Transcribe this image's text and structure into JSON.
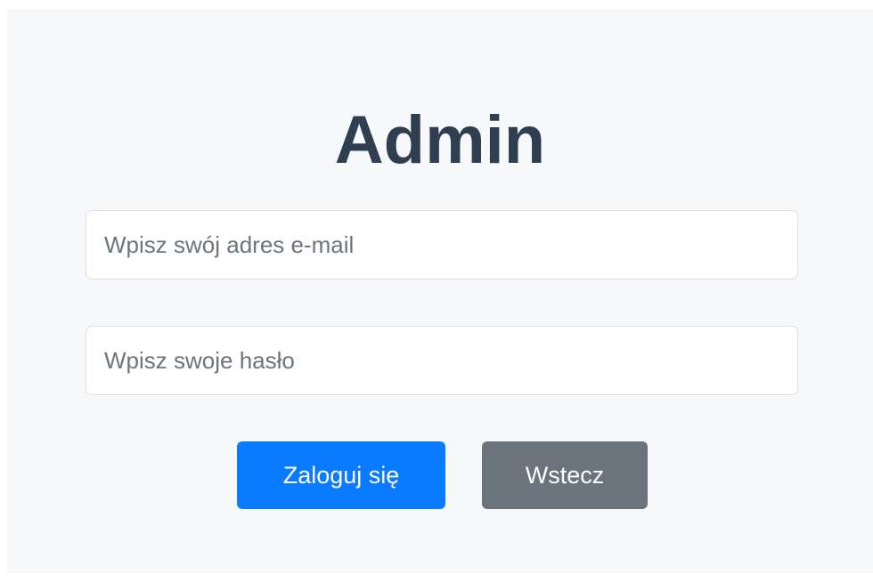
{
  "page": {
    "title": "Admin"
  },
  "form": {
    "email": {
      "placeholder": "Wpisz swój adres e-mail",
      "value": ""
    },
    "password": {
      "placeholder": "Wpisz swoje hasło",
      "value": ""
    },
    "login_label": "Zaloguj się",
    "back_label": "Wstecz"
  },
  "colors": {
    "background": "#f7f8fa",
    "title": "#2f3e50",
    "primary": "#0a7bff",
    "secondary": "#6b737c"
  }
}
